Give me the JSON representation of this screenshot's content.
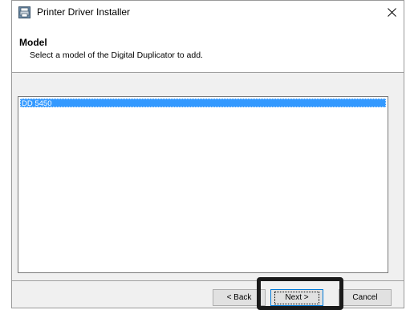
{
  "window": {
    "title": "Printer Driver Installer",
    "icon": "printer-installer-icon",
    "close_icon": "close-icon"
  },
  "header": {
    "title": "Model",
    "subtitle": "Select a model of the Digital Duplicator to add."
  },
  "model_list": {
    "items": [
      {
        "label": "DD 5450",
        "selected": true
      }
    ]
  },
  "buttons": {
    "back": "< Back",
    "next": "Next >",
    "cancel": "Cancel"
  },
  "colors": {
    "selection": "#3399ff",
    "highlight_box": "#1a1a1a",
    "dialog_bg": "#f0f0f0"
  }
}
